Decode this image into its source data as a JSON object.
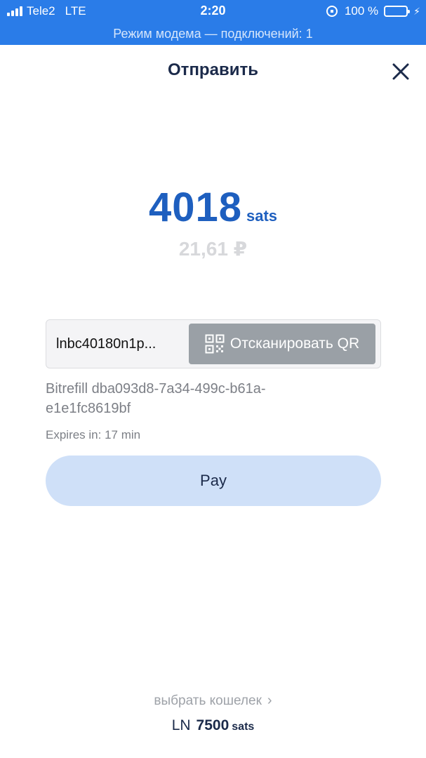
{
  "status_bar": {
    "carrier": "Tele2",
    "network": "LTE",
    "time": "2:20",
    "battery": "100 %"
  },
  "hotspot_banner": "Режим модема — подключений: 1",
  "header": {
    "title": "Отправить"
  },
  "amount": {
    "value": "4018",
    "unit": "sats",
    "fiat": "21,61 ₽"
  },
  "invoice": {
    "value": "lnbc40180n1p...",
    "scan_label": "Отсканировать QR"
  },
  "description": "Bitrefill dba093d8-7a34-499c-b61a-e1e1fc8619bf",
  "expires": "Expires in: 17 min",
  "pay_label": "Pay",
  "wallet": {
    "choose_label": "выбрать кошелек",
    "type": "LN",
    "balance": "7500",
    "unit": "sats"
  },
  "colors": {
    "status_bar": "#2a7ce8",
    "amount": "#1e5fbf",
    "pay_button": "#cfe0f8",
    "scan_button": "#9aa0a6"
  }
}
